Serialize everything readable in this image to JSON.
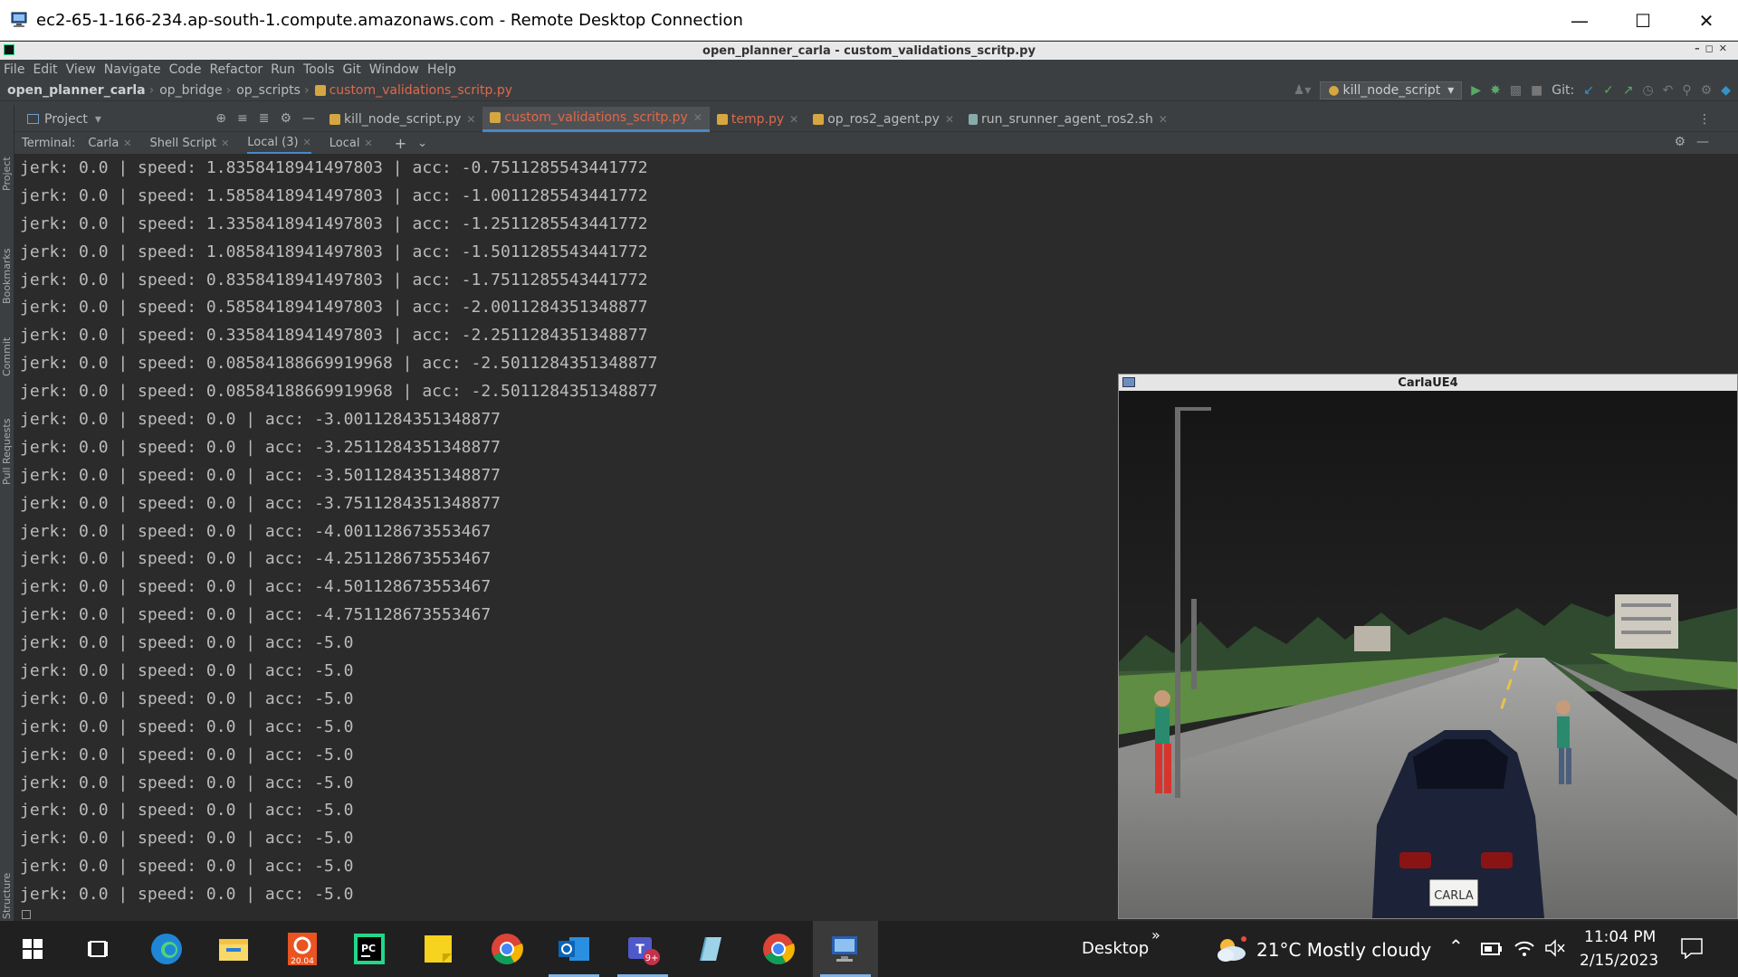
{
  "rdp": {
    "title": "ec2-65-1-166-234.ap-south-1.compute.amazonaws.com - Remote Desktop Connection",
    "icons": [
      "rdp-icon",
      "minimize-icon",
      "maximize-icon",
      "close-icon"
    ]
  },
  "ide": {
    "title": "open_planner_carla - custom_validations_scritp.py",
    "menu": [
      "File",
      "Edit",
      "View",
      "Navigate",
      "Code",
      "Refactor",
      "Run",
      "Tools",
      "Git",
      "Window",
      "Help"
    ],
    "breadcrumb": [
      "open_planner_carla",
      "op_bridge",
      "op_scripts",
      "custom_validations_scritp.py"
    ],
    "run_config": "kill_node_script",
    "git_label": "Git:",
    "project_label": "Project",
    "editor_tabs": [
      {
        "label": "kill_node_script.py",
        "state": "normal"
      },
      {
        "label": "custom_validations_scritp.py",
        "state": "active"
      },
      {
        "label": "temp.py",
        "state": "error"
      },
      {
        "label": "op_ros2_agent.py",
        "state": "normal"
      },
      {
        "label": "run_srunner_agent_ros2.sh",
        "state": "normal"
      }
    ],
    "sidebar_labels": [
      "Project",
      "Bookmarks",
      "Commit",
      "Pull Requests",
      "Structure"
    ],
    "terminal": {
      "label": "Terminal:",
      "tabs": [
        "Carla",
        "Shell Script",
        "Local (3)",
        "Local"
      ],
      "active_tab": "Local (3)",
      "lines": [
        "jerk: 0.0 | speed: 1.8358418941497803 | acc: -0.7511285543441772",
        "jerk: 0.0 | speed: 1.5858418941497803 | acc: -1.0011285543441772",
        "jerk: 0.0 | speed: 1.3358418941497803 | acc: -1.2511285543441772",
        "jerk: 0.0 | speed: 1.0858418941497803 | acc: -1.5011285543441772",
        "jerk: 0.0 | speed: 0.8358418941497803 | acc: -1.7511285543441772",
        "jerk: 0.0 | speed: 0.5858418941497803 | acc: -2.0011284351348877",
        "jerk: 0.0 | speed: 0.3358418941497803 | acc: -2.2511284351348877",
        "jerk: 0.0 | speed: 0.08584188669919968 | acc: -2.5011284351348877",
        "jerk: 0.0 | speed: 0.08584188669919968 | acc: -2.5011284351348877",
        "jerk: 0.0 | speed: 0.0 | acc: -3.0011284351348877",
        "jerk: 0.0 | speed: 0.0 | acc: -3.2511284351348877",
        "jerk: 0.0 | speed: 0.0 | acc: -3.5011284351348877",
        "jerk: 0.0 | speed: 0.0 | acc: -3.7511284351348877",
        "jerk: 0.0 | speed: 0.0 | acc: -4.001128673553467",
        "jerk: 0.0 | speed: 0.0 | acc: -4.251128673553467",
        "jerk: 0.0 | speed: 0.0 | acc: -4.501128673553467",
        "jerk: 0.0 | speed: 0.0 | acc: -4.751128673553467",
        "jerk: 0.0 | speed: 0.0 | acc: -5.0",
        "jerk: 0.0 | speed: 0.0 | acc: -5.0",
        "jerk: 0.0 | speed: 0.0 | acc: -5.0",
        "jerk: 0.0 | speed: 0.0 | acc: -5.0",
        "jerk: 0.0 | speed: 0.0 | acc: -5.0",
        "jerk: 0.0 | speed: 0.0 | acc: -5.0",
        "jerk: 0.0 | speed: 0.0 | acc: -5.0",
        "jerk: 0.0 | speed: 0.0 | acc: -5.0",
        "jerk: 0.0 | speed: 0.0 | acc: -5.0",
        "jerk: 0.0 | speed: 0.0 | acc: -5.0"
      ]
    }
  },
  "carla": {
    "title": "CarlaUE4",
    "plate": "CARLA"
  },
  "taskbar": {
    "desktop_label": "Desktop",
    "weather": "21°C  Mostly cloudy",
    "time": "11:04 PM",
    "date": "2/15/2023",
    "teams_badge": "9+",
    "ubuntu_label": "20.04",
    "apps": [
      "start-icon",
      "task-view-icon",
      "edge-icon",
      "file-explorer-icon",
      "ubuntu-icon",
      "pycharm-icon",
      "sticky-notes-icon",
      "chrome-icon",
      "outlook-icon",
      "teams-icon",
      "notepad-icon",
      "chrome-icon",
      "remote-desktop-icon"
    ]
  },
  "colors": {
    "ide_bg": "#3c3f41",
    "terminal_bg": "#2b2b2b",
    "terminal_text": "#bbbbbb",
    "error_tab": "#e0684b",
    "accent": "#4a88c7",
    "taskbar_bg": "#202020"
  }
}
